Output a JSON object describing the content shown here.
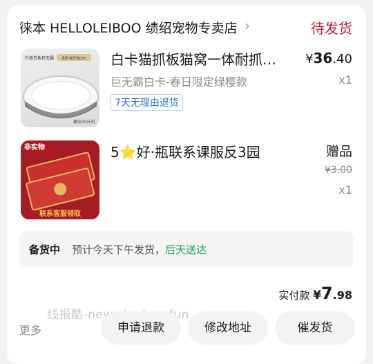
{
  "store": {
    "name": "徕本 HELLOLEIBOO 绩绍宠物专卖店",
    "chevron_icon": "chevron-right-icon"
  },
  "order": {
    "status": "待发货"
  },
  "items": [
    {
      "title": "白卡猫抓板猫窝一体耐抓…",
      "variant": "巨无霸白卡-春日限定绿樱款",
      "tag": "7天无理由退货",
      "price_symbol": "¥",
      "price_int": "36",
      "price_dec": ".40",
      "quantity": "x1",
      "thumb_label_top": "升级白色巨无霸",
      "thumb_label_size": "60*40*9cm",
      "thumb_label_bottom": "建议30斤内"
    },
    {
      "title": "5⭐好·瓶联系课服反3园",
      "gift_label": "赠品",
      "original_price": "¥3.00",
      "quantity": "x1",
      "thumb_badge": "非实物",
      "thumb_footer": "联系客服领取"
    }
  ],
  "shipping": {
    "label": "备货中",
    "text": "预计今天下午发货，",
    "eta": "后天送达"
  },
  "payment": {
    "label": "实付款 ",
    "currency": "¥",
    "int": "7",
    "dec": ".98"
  },
  "watermark": "线报酷-new.xianbao.fun",
  "actions": {
    "more": "更多",
    "refund": "申请退款",
    "change_address": "修改地址",
    "urge": "催发货"
  },
  "colors": {
    "status_red": "#c2203a",
    "tag_blue": "#2c74c9",
    "eta_green": "#1ea05a"
  }
}
